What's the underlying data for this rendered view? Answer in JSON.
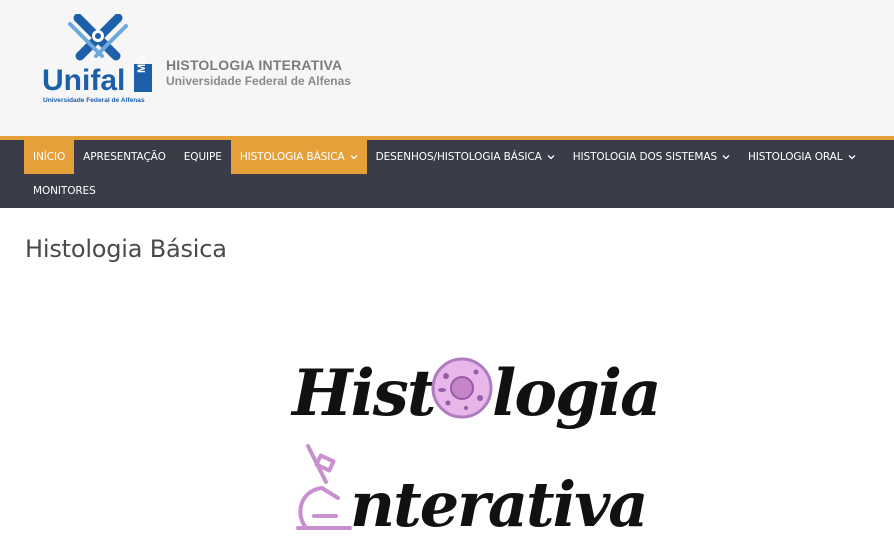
{
  "header": {
    "logo_wordmark": "Unifal",
    "logo_suffix": "MG",
    "logo_tagline": "Universidade Federal de Alfenas",
    "site_title": "HISTOLOGIA INTERATIVA",
    "site_subtitle": "Universidade Federal de Alfenas"
  },
  "nav": {
    "items": [
      {
        "label": "INÍCIO",
        "active": false,
        "highlight": true,
        "dropdown": false
      },
      {
        "label": "APRESENTAÇÃO",
        "active": false,
        "dropdown": false
      },
      {
        "label": "EQUIPE",
        "active": false,
        "dropdown": false
      },
      {
        "label": "HISTOLOGIA BÁSICA",
        "active": true,
        "dropdown": true
      },
      {
        "label": "DESENHOS/HISTOLOGIA BÁSICA",
        "active": false,
        "dropdown": true
      },
      {
        "label": "HISTOLOGIA DOS SISTEMAS",
        "active": false,
        "dropdown": true
      },
      {
        "label": "HISTOLOGIA ORAL",
        "active": false,
        "dropdown": true
      },
      {
        "label": "MONITORES",
        "active": false,
        "dropdown": false
      }
    ]
  },
  "main": {
    "page_title": "Histologia Básica",
    "banner": {
      "line1": "Histologia",
      "line2": "nterativa",
      "icons": [
        "cell-icon",
        "microscope-icon"
      ]
    }
  },
  "colors": {
    "accent": "#e6a03a",
    "nav_bg": "#3a3d48",
    "logo_blue": "#1d5fa8",
    "banner_pink": "#d59bd6"
  }
}
